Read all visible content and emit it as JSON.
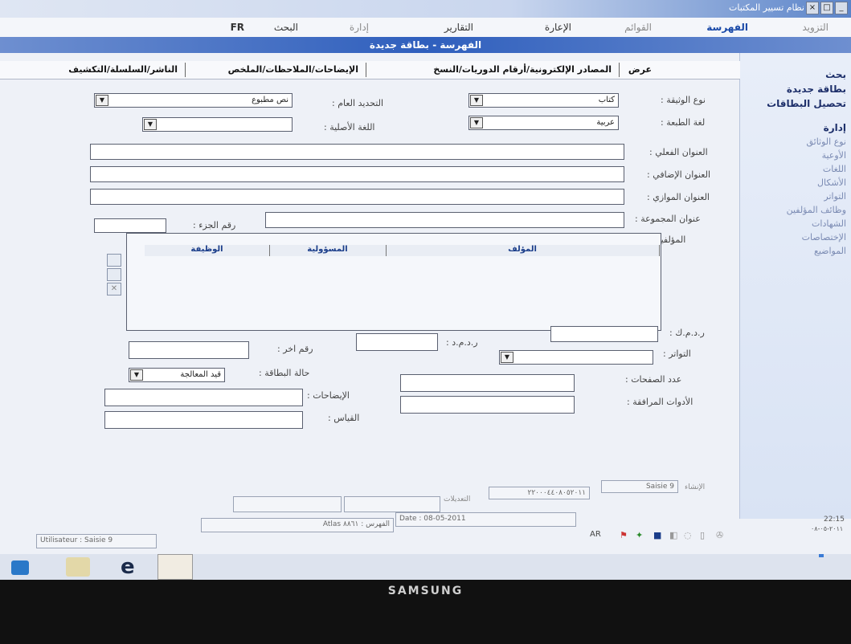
{
  "window": {
    "title": "نظام تسيير المكتبات"
  },
  "menu": {
    "supply": "التزويد",
    "catalog": "الفهرسة",
    "lists": "القوائم",
    "lending": "الإعارة",
    "reports": "التقارير",
    "admin": "إدارة",
    "search": "البحث",
    "lang": "FR"
  },
  "form": {
    "title": "الفهرسة - بطاقة جديدة"
  },
  "sidebar": {
    "search": "بحث",
    "new_card": "بطاقة جديدة",
    "collect_cards": "تحصيل البطاقات",
    "admin": "إدارة",
    "items": [
      "نوع الوثائق",
      "الأوعية",
      "اللغات",
      "الأشكال",
      "التواتر",
      "وظائف المؤلفين",
      "الشهادات",
      "الإختصاصات",
      "المواضيع"
    ]
  },
  "tabs": {
    "view": "عرض",
    "sources": "المصادر الإلكترونية/أرقام الدوريات/النسخ",
    "notes": "الإيضاحات/الملاحظات/الملخص",
    "publisher": "الناشر/السلسلة/التكشيف"
  },
  "fields": {
    "doc_type_label": "نوع الوثيقة :",
    "doc_type_value": "كتاب",
    "general_label": "التحديد العام :",
    "general_value": "نص مطبوع",
    "lang_label": "لغة الطبعة :",
    "lang_value": "عربية",
    "orig_lang_label": "اللغة الأصلية :",
    "actual_title": "العنوان الفعلي :",
    "extra_title": "العنوان الإضافي :",
    "parallel_title": "العنوان الموازي :",
    "collection_title": "عنوان المجموعة :",
    "part_number": "رقم الجزء :",
    "authors": "المؤلفين :",
    "rdmk": "ر.د.م.ك :",
    "rdmd": "ر.د.م.د :",
    "other_number": "رقم اخر :",
    "frequency": "التواتر :",
    "card_state": "حالة البطاقة :",
    "card_state_value": "قيد المعالجة",
    "pages": "عدد الصفحات :",
    "illustrations": "الإيضاحات :",
    "accompanying": "الأدوات المرافقة :",
    "measures": "القياس :"
  },
  "grid": {
    "columns": [
      "المؤلف",
      "المسؤولية",
      "الوظيفة"
    ]
  },
  "statusbar": {
    "created_label": "الإنشاء",
    "created_user": "Saisie 9",
    "modified_label": "التعديلات",
    "code": "٢٢٠٠٠٤٤٠٨٠٥٢٠١١",
    "date": "Date : 08-05-2011",
    "user": "Utilisateur : Saisie 9",
    "catalog": "الفهرس : ٨٨٦١ Atlas",
    "lang": "AR",
    "time": "22:15",
    "tray_date": "٢٠١١-٠٥-٠٨"
  },
  "monitor": {
    "brand": "SAMSUNG"
  }
}
